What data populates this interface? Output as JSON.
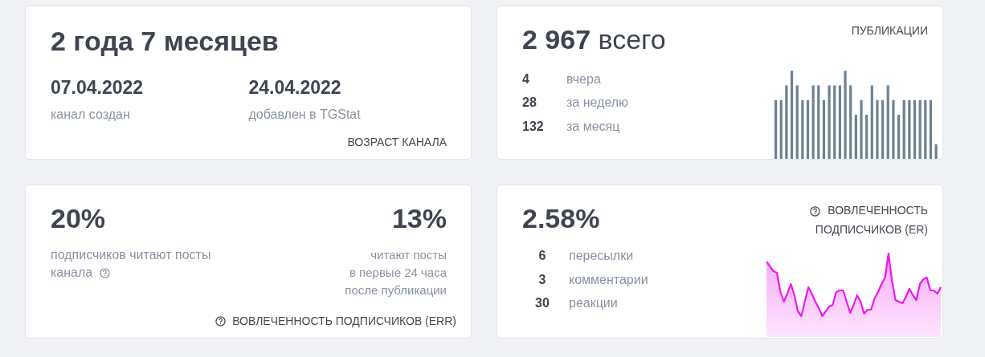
{
  "age_card": {
    "headline": "2 года 7 месяцев",
    "caption": "ВОЗРАСТ КАНАЛА",
    "dates": [
      {
        "value": "07.04.2022",
        "label": "канал создан"
      },
      {
        "value": "24.04.2022",
        "label": "добавлен в TGStat"
      }
    ]
  },
  "posts_card": {
    "total": "2 967",
    "total_suffix": "всего",
    "caption": "ПУБЛИКАЦИИ",
    "stats": [
      {
        "value": "4",
        "label": "вчера"
      },
      {
        "value": "28",
        "label": "за неделю"
      },
      {
        "value": "132",
        "label": "за месяц"
      }
    ]
  },
  "reach_card": {
    "left_value": "20%",
    "left_lines": [
      "подписчиков читают посты",
      "канала"
    ],
    "right_value": "13%",
    "right_lines": [
      "читают посты",
      "в первые 24 часа",
      "после публикации"
    ],
    "caption": "ВОВЛЕЧЕННОСТЬ ПОДПИСЧИКОВ (ERR)"
  },
  "er_card": {
    "value": "2.58%",
    "caption_lines": [
      "ВОВЛЕЧЕННОСТЬ",
      "ПОДПИСЧИКОВ (ER)"
    ],
    "stats": [
      {
        "value": "6",
        "label": "пересылки"
      },
      {
        "value": "3",
        "label": "комментарии"
      },
      {
        "value": "30",
        "label": "реакции"
      }
    ]
  }
}
